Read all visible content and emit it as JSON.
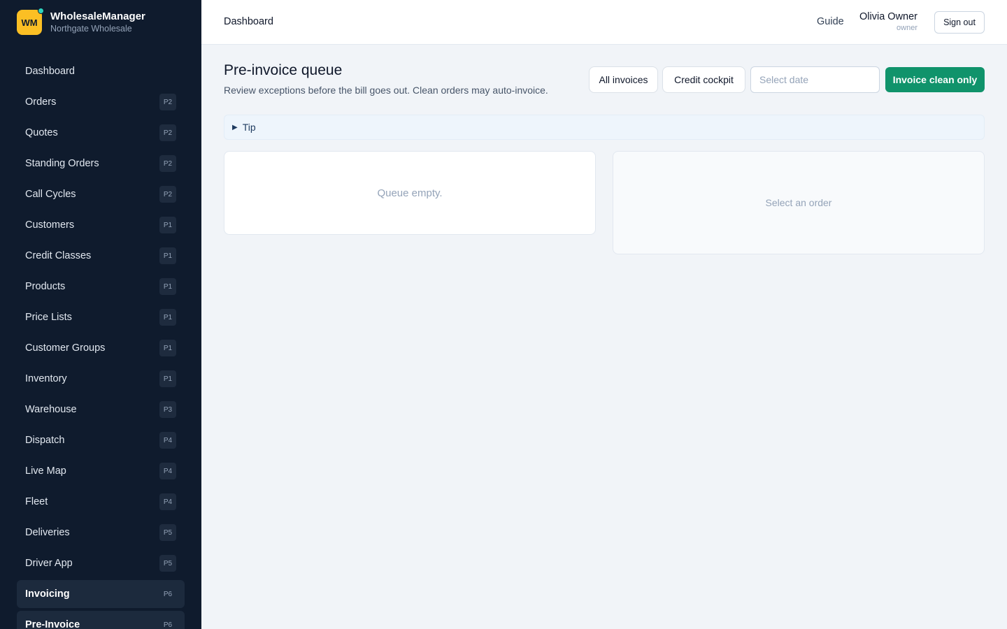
{
  "brand": {
    "logo_text": "WM",
    "name": "WholesaleManager",
    "org": "Northgate Wholesale",
    "logo_color": "#fbbf24",
    "status_dot_color": "#2dd4bf"
  },
  "sidebar": {
    "items": [
      {
        "label": "Dashboard",
        "badge": ""
      },
      {
        "label": "Orders",
        "badge": "P2"
      },
      {
        "label": "Quotes",
        "badge": "P2"
      },
      {
        "label": "Standing Orders",
        "badge": "P2"
      },
      {
        "label": "Call Cycles",
        "badge": "P2"
      },
      {
        "label": "Customers",
        "badge": "P1"
      },
      {
        "label": "Credit Classes",
        "badge": "P1"
      },
      {
        "label": "Products",
        "badge": "P1"
      },
      {
        "label": "Price Lists",
        "badge": "P1"
      },
      {
        "label": "Customer Groups",
        "badge": "P1"
      },
      {
        "label": "Inventory",
        "badge": "P1"
      },
      {
        "label": "Warehouse",
        "badge": "P3"
      },
      {
        "label": "Dispatch",
        "badge": "P4"
      },
      {
        "label": "Live Map",
        "badge": "P4"
      },
      {
        "label": "Fleet",
        "badge": "P4"
      },
      {
        "label": "Deliveries",
        "badge": "P5"
      },
      {
        "label": "Driver App",
        "badge": "P5"
      },
      {
        "label": "Invoicing",
        "badge": "P6",
        "active": true
      },
      {
        "label": "Pre-Invoice",
        "badge": "P6",
        "active": true
      }
    ]
  },
  "header": {
    "title": "Dashboard",
    "guide_label": "Guide",
    "user_name": "Olivia Owner",
    "user_role": "owner",
    "signout_label": "Sign out"
  },
  "main": {
    "title": "Pre-invoice queue",
    "subtitle": "Review exceptions before the bill goes out. Clean orders may auto-invoice.",
    "all_invoices_label": "All invoices",
    "credit_cockpit_label": "Credit cockpit",
    "date_placeholder": "Select date",
    "invoice_clean_label": "Invoice clean only",
    "accent_color": "#10936b",
    "tip_label": "Tip",
    "queue_empty_text": "Queue empty.",
    "detail_empty_text": "Select an order"
  }
}
